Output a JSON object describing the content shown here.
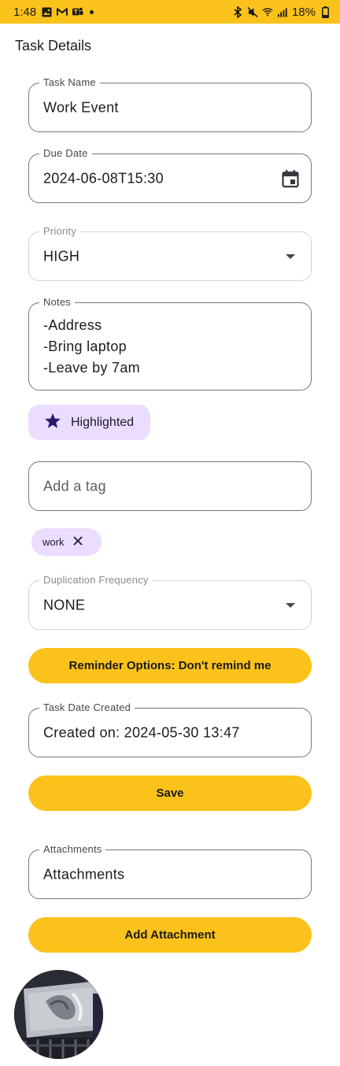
{
  "status_bar": {
    "time": "1:48",
    "battery": "18%",
    "left_icons": [
      "image-icon",
      "gmail-icon",
      "teams-icon",
      "notification-dot-icon"
    ],
    "right_icons": [
      "bluetooth-icon",
      "mute-icon",
      "wifi-icon",
      "signal-icon",
      "battery-icon"
    ]
  },
  "page": {
    "title": "Task Details"
  },
  "task_name": {
    "label": "Task Name",
    "value": "Work Event"
  },
  "due_date": {
    "label": "Due Date",
    "value": "2024-06-08T15:30",
    "icon": "calendar-icon"
  },
  "priority": {
    "label": "Priority",
    "value": "HIGH",
    "icon": "dropdown-arrow-icon"
  },
  "notes": {
    "label": "Notes",
    "lines": [
      "-Address",
      "-Bring laptop",
      "-Leave by 7am"
    ]
  },
  "highlight_chip": {
    "label": "Highlighted",
    "icon": "star-icon"
  },
  "tag_input": {
    "placeholder": "Add a tag"
  },
  "tags": [
    {
      "label": "work",
      "icon": "close-icon"
    }
  ],
  "duplication": {
    "label": "Duplication Frequency",
    "value": "NONE",
    "icon": "dropdown-arrow-icon"
  },
  "reminder_button": {
    "label": "Reminder Options: Don't remind me"
  },
  "date_created": {
    "label": "Task Date Created",
    "value": "Created on: 2024-05-30 13:47"
  },
  "save_button": {
    "label": "Save"
  },
  "attachments": {
    "label": "Attachments",
    "value": "Attachments"
  },
  "add_attachment_button": {
    "label": "Add Attachment"
  },
  "colors": {
    "accent": "#fbc21b",
    "chip": "#eaddff",
    "outline": "#79747e",
    "text": "#1c1b1f",
    "star": "#2a1a6e"
  }
}
